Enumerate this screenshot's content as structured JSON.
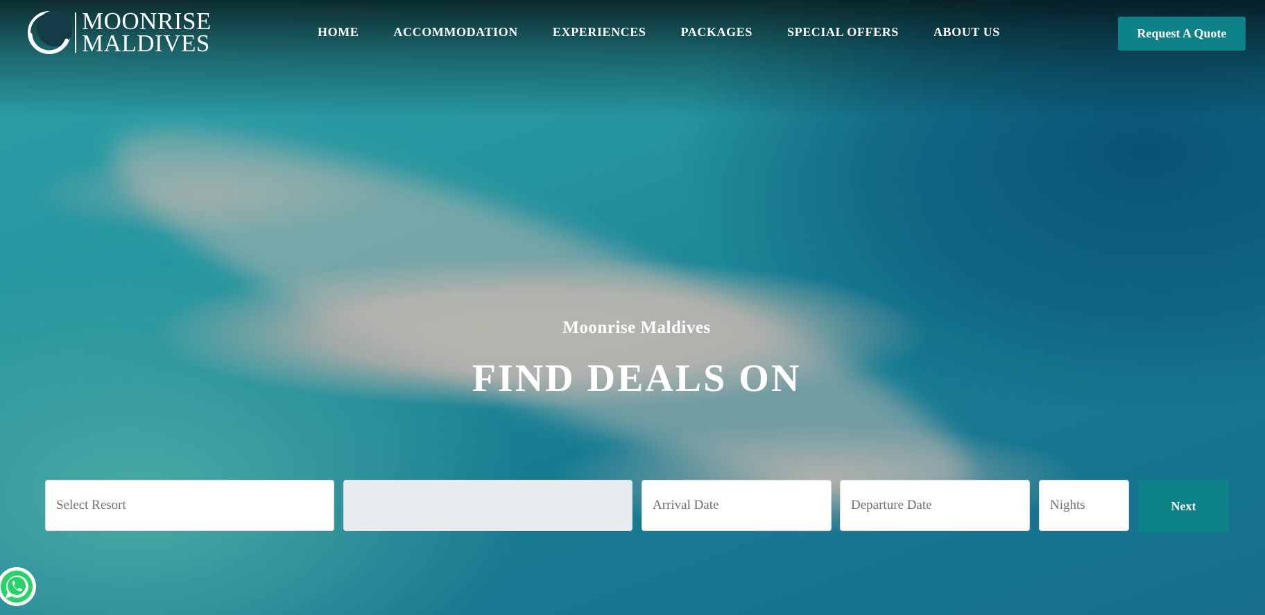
{
  "brand": {
    "line1": "MOONRISE",
    "line2": "MALDIVES"
  },
  "nav": {
    "items": [
      {
        "label": "HOME"
      },
      {
        "label": "ACCOMMODATION"
      },
      {
        "label": "EXPERIENCES"
      },
      {
        "label": "PACKAGES"
      },
      {
        "label": "SPECIAL OFFERS"
      },
      {
        "label": "ABOUT US"
      }
    ],
    "quote_label": "Request A Quote"
  },
  "hero": {
    "subtitle": "Moonrise Maldives",
    "headline": "FIND DEALS ON"
  },
  "search": {
    "resort_placeholder": "Select Resort",
    "second_value": "",
    "arrival_placeholder": "Arrival Date",
    "departure_placeholder": "Departure Date",
    "nights_placeholder": "Nights",
    "next_label": "Next"
  },
  "colors": {
    "accent": "#0e8387",
    "whatsapp": "#25d366"
  },
  "icons": {
    "logo": "crescent-moon-icon",
    "chat": "whatsapp-icon"
  }
}
